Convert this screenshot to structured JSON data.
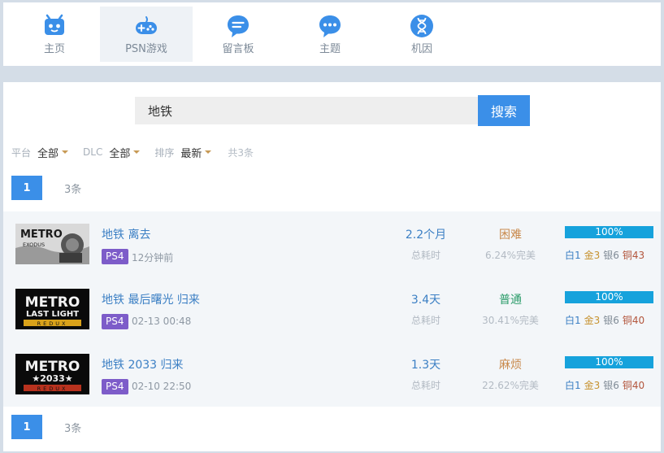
{
  "nav": {
    "items": [
      {
        "label": "主页",
        "icon": "game-console-icon"
      },
      {
        "label": "PSN游戏",
        "icon": "gamepad-icon"
      },
      {
        "label": "留言板",
        "icon": "message-board-icon"
      },
      {
        "label": "主题",
        "icon": "chat-bubble-icon"
      },
      {
        "label": "机因",
        "icon": "dna-icon"
      }
    ],
    "active_index": 1
  },
  "search": {
    "value": "地铁",
    "button_label": "搜索"
  },
  "filters": {
    "platform_label": "平台",
    "platform_value": "全部",
    "dlc_label": "DLC",
    "dlc_value": "全部",
    "sort_label": "排序",
    "sort_value": "最新",
    "total": "共3条"
  },
  "pager": {
    "current_page": "1",
    "count": "3条"
  },
  "games": [
    {
      "title": "地铁 离去",
      "platform": "PS4",
      "time": "12分钟前",
      "duration": "2.2个月",
      "duration_label": "总耗时",
      "difficulty": "困难",
      "difficulty_color": "#c8884a",
      "perfect_rate": "6.24%完美",
      "progress_text": "100%",
      "progress": 1.0,
      "trophies": {
        "platinum": "白1",
        "gold": "金3",
        "silver": "银6",
        "bronze": "铜43"
      },
      "logo": {
        "line1": "METRO",
        "line2": "EXODUS",
        "line3": ""
      }
    },
    {
      "title": "地铁 最后曙光 归来",
      "platform": "PS4",
      "time": "02-13 00:48",
      "duration": "3.4天",
      "duration_label": "总耗时",
      "difficulty": "普通",
      "difficulty_color": "#2c9c6a",
      "perfect_rate": "30.41%完美",
      "progress_text": "100%",
      "progress": 1.0,
      "trophies": {
        "platinum": "白1",
        "gold": "金3",
        "silver": "银6",
        "bronze": "铜40"
      },
      "logo": {
        "line1": "METRO",
        "line2": "LAST LIGHT",
        "line3": "REDUX"
      }
    },
    {
      "title": "地铁 2033 归来",
      "platform": "PS4",
      "time": "02-10 22:50",
      "duration": "1.3天",
      "duration_label": "总耗时",
      "difficulty": "麻烦",
      "difficulty_color": "#c8884a",
      "perfect_rate": "22.62%完美",
      "progress_text": "100%",
      "progress": 1.0,
      "trophies": {
        "platinum": "白1",
        "gold": "金3",
        "silver": "银6",
        "bronze": "铜40"
      },
      "logo": {
        "line1": "METRO",
        "line2": "★2033★",
        "line3": "REDUX"
      }
    }
  ],
  "colors": {
    "accent": "#3b8fe8",
    "nav_icon": "#3b8fe8",
    "ps4_badge": "#7d5cc9",
    "progress": "#16a2dc"
  }
}
